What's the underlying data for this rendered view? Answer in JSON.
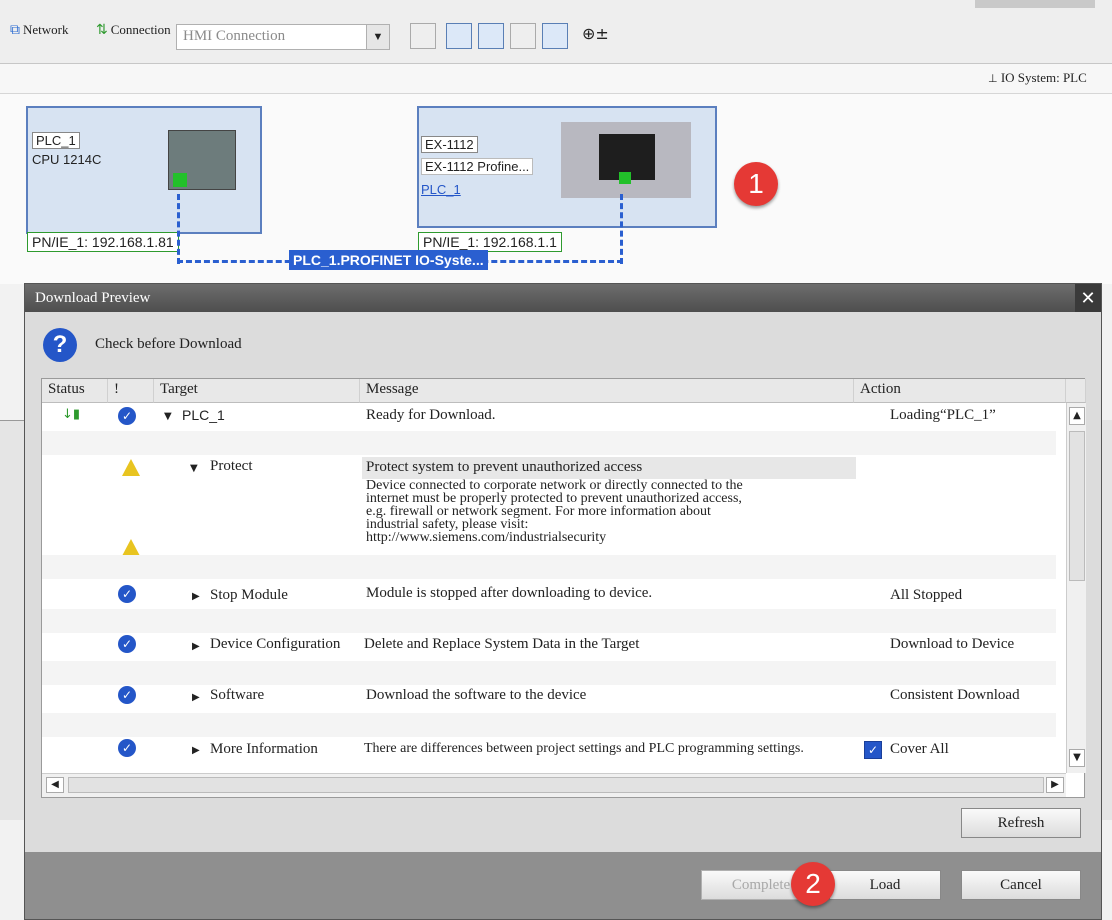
{
  "toolbar": {
    "network_label": "Network",
    "connection_label": "Connection",
    "connection_value": "HMI Connection",
    "io_system_label": "IO System: PLC"
  },
  "network": {
    "device1": {
      "name": "PLC_1",
      "type": "CPU 1214C",
      "interface": "PN/IE_1: 192.168.1.81"
    },
    "device2": {
      "name": "EX-1112",
      "type": "EX-1112 Profine...",
      "assigned": "PLC_1",
      "interface": "PN/IE_1: 192.168.1.1"
    },
    "io_system_link": "PLC_1.PROFINET IO-Syste..."
  },
  "badges": {
    "one": "1",
    "two": "2"
  },
  "dialog": {
    "title": "Download Preview",
    "heading": "Check before Download",
    "columns": {
      "status": "Status",
      "bang": "!",
      "target": "Target",
      "message": "Message",
      "action": "Action"
    },
    "rows": {
      "plc": {
        "target": "PLC_1",
        "message": "Ready for Download.",
        "action": "Loading“PLC_1”"
      },
      "protect": {
        "target": "Protect",
        "message": "Protect system to prevent unauthorized access",
        "detail1": "Device connected to corporate network or directly connected to the",
        "detail2": "internet must be properly protected to prevent unauthorized access,",
        "detail3": "e.g. firewall or network segment. For more information about",
        "detail4": "industrial safety, please visit:",
        "detail5": "http://www.siemens.com/industrialsecurity"
      },
      "stop": {
        "target": "Stop Module",
        "message": "Module is stopped after downloading to device.",
        "action": "All Stopped"
      },
      "devconf": {
        "target": "Device Configuration",
        "message": "Delete and Replace System Data in the Target",
        "action": "Download to Device"
      },
      "software": {
        "target": "Software",
        "message": "Download the software to the device",
        "action": "Consistent Download"
      },
      "more": {
        "target": "More Information",
        "message": "There are differences between project settings and PLC programming settings.",
        "action": "Cover All"
      }
    },
    "buttons": {
      "refresh": "Refresh",
      "complete": "Complete",
      "load": "Load",
      "cancel": "Cancel"
    }
  },
  "colors": {
    "accent": "#2456c8",
    "badge": "#e53935",
    "warning": "#e8c420",
    "link_green": "#2e9a2e"
  }
}
